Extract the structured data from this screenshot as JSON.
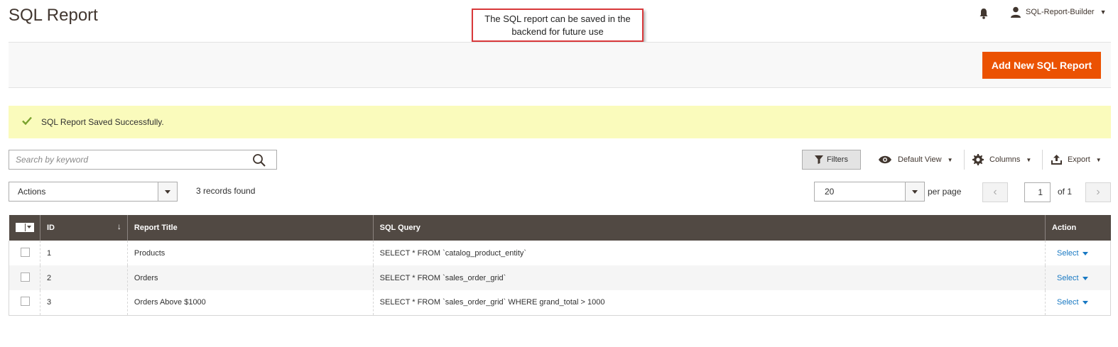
{
  "header": {
    "page_title": "SQL Report",
    "user_name": "SQL-Report-Builder"
  },
  "callout": {
    "text": "The SQL report can be saved in the backend for future use"
  },
  "actions_bar": {
    "add_button_label": "Add New SQL Report",
    "accent_color": "#eb5202"
  },
  "message": {
    "text": "SQL Report Saved Successfully.",
    "type": "success"
  },
  "toolbar": {
    "search_placeholder": "Search by keyword",
    "filters_label": "Filters",
    "default_view_label": "Default View",
    "columns_label": "Columns",
    "export_label": "Export",
    "actions_label": "Actions",
    "records_found": "3 records found",
    "per_page_value": "20",
    "per_page_label": "per page",
    "current_page": "1",
    "total_pages_label": "of 1"
  },
  "grid": {
    "columns": [
      "ID",
      "Report Title",
      "SQL Query",
      "Action"
    ],
    "rows": [
      {
        "id": "1",
        "title": "Products",
        "query": "SELECT * FROM `catalog_product_entity`",
        "action": "Select"
      },
      {
        "id": "2",
        "title": "Orders",
        "query": "SELECT * FROM `sales_order_grid`",
        "action": "Select"
      },
      {
        "id": "3",
        "title": "Orders Above $1000",
        "query": "SELECT * FROM `sales_order_grid` WHERE grand_total > 1000",
        "action": "Select"
      }
    ]
  }
}
